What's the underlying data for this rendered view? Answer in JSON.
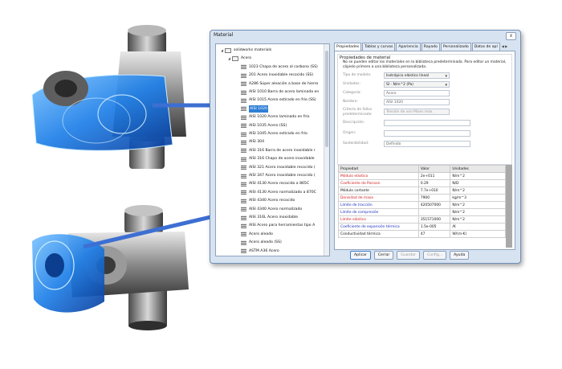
{
  "window": {
    "title": "Material",
    "close_label": "x"
  },
  "tree": {
    "items": [
      {
        "label": "solidworks materials",
        "level": 0,
        "kind": "folder",
        "expand": "◢"
      },
      {
        "label": "Acero",
        "level": 1,
        "kind": "folder",
        "expand": "◢"
      },
      {
        "label": "1023 Chapa de acero al carbono (SS)",
        "level": 2,
        "kind": "material"
      },
      {
        "label": "201 Acero inoxidable recocido (SS)",
        "level": 2,
        "kind": "material"
      },
      {
        "label": "A286 Súper aleación a base de hierro",
        "level": 2,
        "kind": "material"
      },
      {
        "label": "AISI 1010 Barra de acero laminada en",
        "level": 2,
        "kind": "material"
      },
      {
        "label": "AISI 1015 Acero estirado en frío (SS)",
        "level": 2,
        "kind": "material"
      },
      {
        "label": "AISI 1020",
        "level": 2,
        "kind": "material",
        "selected": true
      },
      {
        "label": "AISI 1020 Acero laminado en frío",
        "level": 2,
        "kind": "material"
      },
      {
        "label": "AISI 1035 Acero (SS)",
        "level": 2,
        "kind": "material"
      },
      {
        "label": "AISI 1045 Acero estirado en frío",
        "level": 2,
        "kind": "material"
      },
      {
        "label": "AISI 304",
        "level": 2,
        "kind": "material"
      },
      {
        "label": "AISI 316 Barra de acero inoxidable r",
        "level": 2,
        "kind": "material"
      },
      {
        "label": "AISI 316 Chapa de acero inoxidable",
        "level": 2,
        "kind": "material"
      },
      {
        "label": "AISI 321 Acero inoxidable recocido (",
        "level": 2,
        "kind": "material"
      },
      {
        "label": "AISI 347 Acero inoxidable recocido (",
        "level": 2,
        "kind": "material"
      },
      {
        "label": "AISI 4130 Acero recocido a 865C",
        "level": 2,
        "kind": "material"
      },
      {
        "label": "AISI 4130 Acero normalizado a 870C",
        "level": 2,
        "kind": "material"
      },
      {
        "label": "AISI 4340 Acero recocido",
        "level": 2,
        "kind": "material"
      },
      {
        "label": "AISI 4340 Acero normalizado",
        "level": 2,
        "kind": "material"
      },
      {
        "label": "AISI 316L Acero inoxidable",
        "level": 2,
        "kind": "material"
      },
      {
        "label": "AISI Acero para herramientas tipo A",
        "level": 2,
        "kind": "material"
      },
      {
        "label": "Acero aleado",
        "level": 2,
        "kind": "material"
      },
      {
        "label": "Acero aleado (SS)",
        "level": 2,
        "kind": "material"
      },
      {
        "label": "ASTM A36 Acero",
        "level": 2,
        "kind": "material"
      }
    ]
  },
  "tabs": [
    "Propiedades",
    "Tablas y curvas",
    "Apariencia",
    "Rayado",
    "Personalizado",
    "Datos de apl"
  ],
  "tab_scroll": "◀ ▶",
  "properties": {
    "group_title": "Propiedades de material",
    "note": "No se pueden editar los materiales en la biblioteca predeterminada. Para editar un material, cópielo primero a una biblioteca personalizada.",
    "fields": [
      {
        "label": "Tipo de modelo:",
        "value": "Isotrópico elástico lineal",
        "kind": "select"
      },
      {
        "label": "Unidades:",
        "value": "SI - N/m^2 (Pa)",
        "kind": "select"
      },
      {
        "label": "Categoría:",
        "value": "Acero",
        "kind": "text"
      },
      {
        "label": "Nombre:",
        "value": "AISI 1020",
        "kind": "text"
      },
      {
        "label": "Criterio de fallos predeterminado:",
        "value": "Tensión de von Mises máx.",
        "kind": "disabled"
      },
      {
        "label": "Descripción:",
        "value": "",
        "kind": "wide"
      },
      {
        "label": "Origen:",
        "value": "",
        "kind": "wide"
      },
      {
        "label": "Sostenibilidad:",
        "value": "Definido",
        "kind": "wide"
      }
    ]
  },
  "table": {
    "headers": [
      "Propiedad",
      "Valor",
      "Unidades"
    ],
    "rows": [
      {
        "name": "Módulo elástico",
        "value": "2e+011",
        "unit": "N/m^2",
        "color": "#d02020"
      },
      {
        "name": "Coeficiente de Poisson",
        "value": "0.29",
        "unit": "N/D",
        "color": "#d02020"
      },
      {
        "name": "Módulo cortante",
        "value": "7.7e+010",
        "unit": "N/m^2",
        "color": "#111111"
      },
      {
        "name": "Densidad de masa",
        "value": "7900",
        "unit": "kg/m^3",
        "color": "#d02020"
      },
      {
        "name": "Límite de tracción",
        "value": "420507000",
        "unit": "N/m^2",
        "color": "#1a2fbf"
      },
      {
        "name": "Límite de compresión",
        "value": "",
        "unit": "N/m^2",
        "color": "#1a2fbf"
      },
      {
        "name": "Límite elástico",
        "value": "351571000",
        "unit": "N/m^2",
        "color": "#d02020"
      },
      {
        "name": "Coeficiente de expansión térmica",
        "value": "1.5e-005",
        "unit": "/K",
        "color": "#1a2fbf"
      },
      {
        "name": "Conductividad térmica",
        "value": "47",
        "unit": "W/(m·K)",
        "color": "#111111"
      }
    ]
  },
  "buttons": [
    {
      "label": "Aplicar",
      "state": "primary"
    },
    {
      "label": "Cerrar",
      "state": "normal"
    },
    {
      "label": "Guardar",
      "state": "disabled"
    },
    {
      "label": "Config...",
      "state": "disabled"
    },
    {
      "label": "Ayuda",
      "state": "normal"
    }
  ],
  "colors": {
    "selection": "#2f7fd6",
    "highlight_blue": "#1e7fe8",
    "arrow": "#3d6fd2"
  }
}
